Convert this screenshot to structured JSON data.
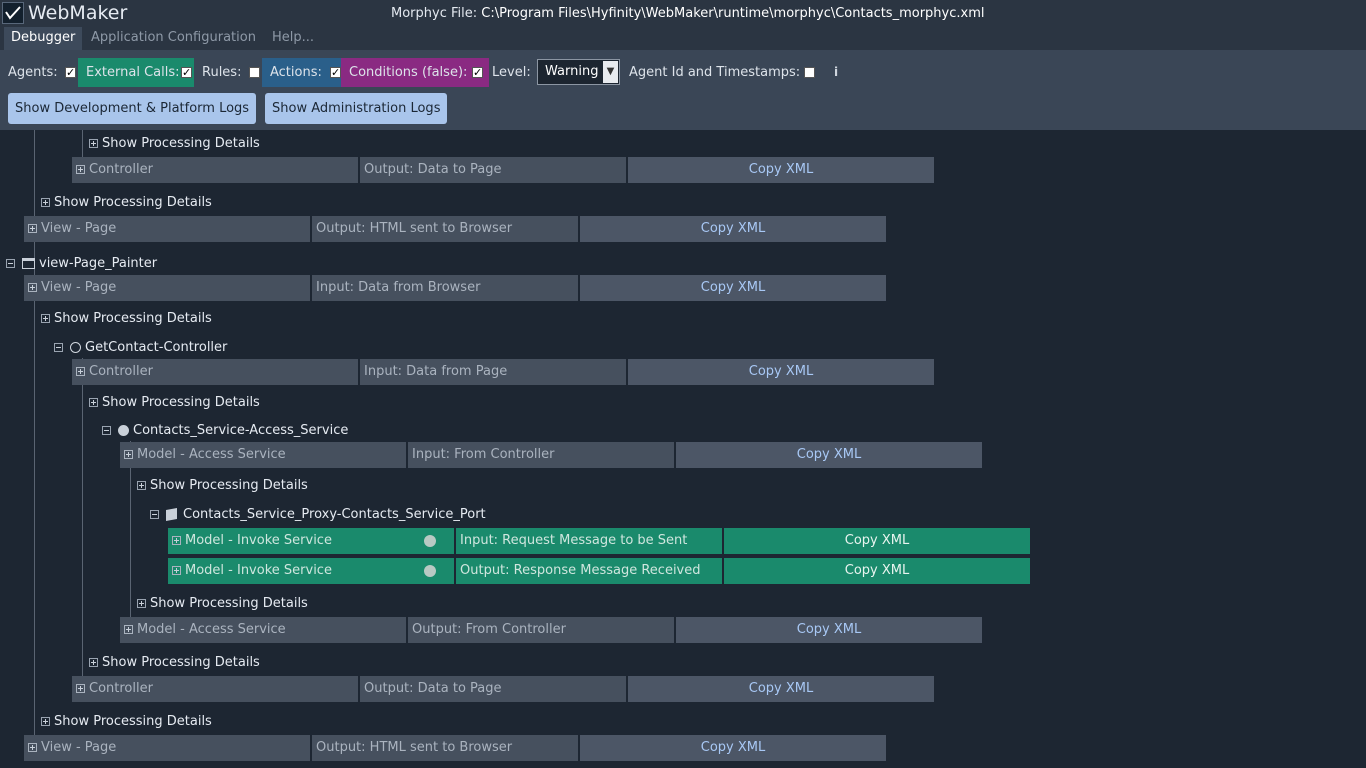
{
  "app": {
    "name": "WebMaker",
    "file_label": "Morphyc File:",
    "file_path": "C:\\Program Files\\Hyfinity\\WebMaker\\runtime\\morphyc\\Contacts_morphyc.xml"
  },
  "menu": {
    "items": [
      "Debugger",
      "Application Configuration",
      "Help..."
    ],
    "active": "Debugger"
  },
  "toolbar": {
    "filters": [
      {
        "label": "Agents:",
        "checked": true,
        "color": "#3a4656"
      },
      {
        "label": "External Calls:",
        "checked": true,
        "color": "#1a8a6c"
      },
      {
        "label": "Rules:",
        "checked": false,
        "color": "#3a4656"
      },
      {
        "label": "Actions:",
        "checked": true,
        "color": "#2a5f8a"
      },
      {
        "label": "Conditions (false):",
        "checked": true,
        "color": "#8a2a82"
      }
    ],
    "level_label": "Level:",
    "level_value": "Warning",
    "agent_id_label": "Agent Id and Timestamps:",
    "agent_id_checked": false,
    "info_icon": "i",
    "buttons": [
      "Show Development & Platform Logs",
      "Show Administration Logs"
    ]
  },
  "tree": {
    "show_processing_label": "Show Processing Details",
    "copy_label": "Copy XML",
    "rows": [
      {
        "name": "Controller",
        "io": "Output: Data to Page"
      },
      {
        "name": "View - Page",
        "io": "Output: HTML sent to Browser"
      },
      {
        "name": "View - Page",
        "io": "Input: Data from Browser"
      },
      {
        "name": "Controller",
        "io": "Input: Data from Page"
      },
      {
        "name": "Model - Access Service",
        "io": "Input: From Controller"
      },
      {
        "name": "Model - Invoke Service",
        "io": "Input: Request Message to be Sent"
      },
      {
        "name": "Model - Invoke Service",
        "io": "Output: Response Message Received"
      },
      {
        "name": "Model - Access Service",
        "io": "Output: From Controller"
      },
      {
        "name": "Controller",
        "io": "Output: Data to Page"
      },
      {
        "name": "View - Page",
        "io": "Output: HTML sent to Browser"
      }
    ],
    "nodes": [
      {
        "label": "view-Page_Painter",
        "icon": "window-icon"
      },
      {
        "label": "GetContact-Controller",
        "icon": "circle-icon"
      },
      {
        "label": "Contacts_Service-Access_Service",
        "icon": "globe-icon"
      },
      {
        "label": "Contacts_Service_Proxy-Contacts_Service_Port",
        "icon": "cube-icon"
      }
    ]
  }
}
